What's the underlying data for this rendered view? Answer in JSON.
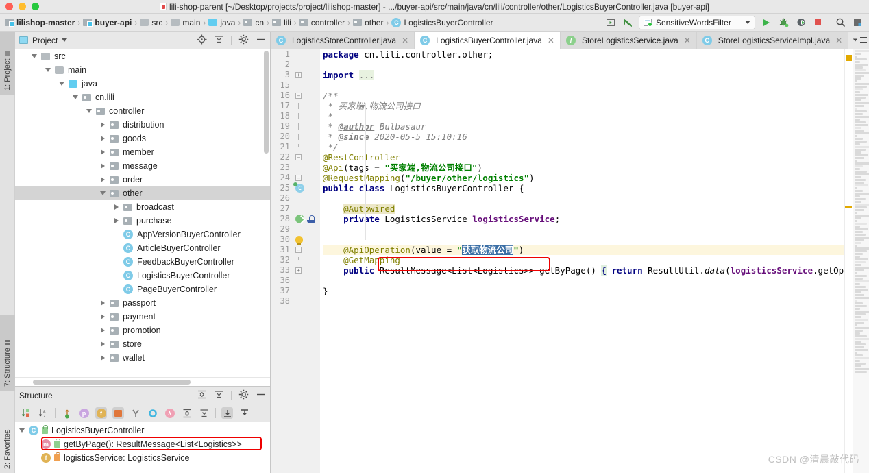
{
  "window": {
    "title": "lili-shop-parent [~/Desktop/projects/project/lilishop-master] - .../buyer-api/src/main/java/cn/lili/controller/other/LogisticsBuyerController.java [buyer-api]"
  },
  "navbar": {
    "breadcrumbs": [
      {
        "label": "lilishop-master",
        "icon": "module-icon",
        "bold": true
      },
      {
        "label": "buyer-api",
        "icon": "module-icon",
        "bold": true
      },
      {
        "label": "src",
        "icon": "folder-icon",
        "bold": false
      },
      {
        "label": "main",
        "icon": "folder-icon",
        "bold": false
      },
      {
        "label": "java",
        "icon": "source-folder-icon",
        "bold": false
      },
      {
        "label": "cn",
        "icon": "package-icon",
        "bold": false
      },
      {
        "label": "lili",
        "icon": "package-icon",
        "bold": false
      },
      {
        "label": "controller",
        "icon": "package-icon",
        "bold": false
      },
      {
        "label": "other",
        "icon": "package-icon",
        "bold": false
      },
      {
        "label": "LogisticsBuyerController",
        "icon": "class-icon",
        "bold": false
      }
    ],
    "separator": "›",
    "run_config": "SensitiveWordsFilter",
    "actions": [
      "run-button",
      "debug-button",
      "run-coverage-button",
      "stop-button",
      "search-everywhere-button",
      "layout-button"
    ]
  },
  "project_panel": {
    "title": "Project",
    "tree": [
      {
        "label": "src",
        "depth": 2,
        "arrow": "down",
        "icon": "folder-icon",
        "selected": false
      },
      {
        "label": "main",
        "depth": 3,
        "arrow": "down",
        "icon": "folder-icon",
        "selected": false
      },
      {
        "label": "java",
        "depth": 4,
        "arrow": "down",
        "icon": "source-folder-icon",
        "selected": false
      },
      {
        "label": "cn.lili",
        "depth": 5,
        "arrow": "down",
        "icon": "package-icon",
        "selected": false
      },
      {
        "label": "controller",
        "depth": 6,
        "arrow": "down",
        "icon": "package-icon",
        "selected": false
      },
      {
        "label": "distribution",
        "depth": 7,
        "arrow": "right",
        "icon": "package-icon",
        "selected": false
      },
      {
        "label": "goods",
        "depth": 7,
        "arrow": "right",
        "icon": "package-icon",
        "selected": false
      },
      {
        "label": "member",
        "depth": 7,
        "arrow": "right",
        "icon": "package-icon",
        "selected": false
      },
      {
        "label": "message",
        "depth": 7,
        "arrow": "right",
        "icon": "package-icon",
        "selected": false
      },
      {
        "label": "order",
        "depth": 7,
        "arrow": "right",
        "icon": "package-icon",
        "selected": false
      },
      {
        "label": "other",
        "depth": 7,
        "arrow": "down",
        "icon": "package-icon",
        "selected": true
      },
      {
        "label": "broadcast",
        "depth": 8,
        "arrow": "right",
        "icon": "package-icon",
        "selected": false
      },
      {
        "label": "purchase",
        "depth": 8,
        "arrow": "right",
        "icon": "package-icon",
        "selected": false
      },
      {
        "label": "AppVersionBuyerController",
        "depth": 8,
        "arrow": "none",
        "icon": "class-icon",
        "selected": false
      },
      {
        "label": "ArticleBuyerController",
        "depth": 8,
        "arrow": "none",
        "icon": "class-icon",
        "selected": false
      },
      {
        "label": "FeedbackBuyerController",
        "depth": 8,
        "arrow": "none",
        "icon": "class-icon",
        "selected": false
      },
      {
        "label": "LogisticsBuyerController",
        "depth": 8,
        "arrow": "none",
        "icon": "class-icon",
        "selected": false
      },
      {
        "label": "PageBuyerController",
        "depth": 8,
        "arrow": "none",
        "icon": "class-icon",
        "selected": false
      },
      {
        "label": "passport",
        "depth": 7,
        "arrow": "right",
        "icon": "package-icon",
        "selected": false
      },
      {
        "label": "payment",
        "depth": 7,
        "arrow": "right",
        "icon": "package-icon",
        "selected": false
      },
      {
        "label": "promotion",
        "depth": 7,
        "arrow": "right",
        "icon": "package-icon",
        "selected": false
      },
      {
        "label": "store",
        "depth": 7,
        "arrow": "right",
        "icon": "package-icon",
        "selected": false
      },
      {
        "label": "wallet",
        "depth": 7,
        "arrow": "right",
        "icon": "package-icon",
        "selected": false
      }
    ]
  },
  "structure_panel": {
    "title": "Structure",
    "items": [
      {
        "label": "LogisticsBuyerController",
        "depth": 0,
        "arrow": "down",
        "kind": "class-icon",
        "visibility": "public",
        "highlighted": false
      },
      {
        "label": "getByPage(): ResultMessage<List<Logistics>>",
        "depth": 1,
        "arrow": "none",
        "kind": "method-icon",
        "visibility": "public",
        "highlighted": true
      },
      {
        "label": "logisticsService: LogisticsService",
        "depth": 1,
        "arrow": "none",
        "kind": "field-icon",
        "visibility": "private",
        "highlighted": false
      }
    ],
    "toolbar_icons": [
      "sort-by-visibility-icon",
      "sort-alphabetically-icon",
      "show-inherited-icon",
      "show-properties-icon",
      "show-fields-icon",
      "show-non-public-icon",
      "show-anonymous-icon",
      "show-interfaces-icon",
      "show-lambdas-icon",
      "expand-all-icon",
      "collapse-all-icon",
      "autoscroll-to-source-icon",
      "autoscroll-from-source-icon"
    ]
  },
  "sidebar_tabs": {
    "left": [
      {
        "label": "1: Project",
        "active": true
      },
      {
        "label": "7: Structure",
        "active": true
      },
      {
        "label": "2: Favorites",
        "active": false
      }
    ]
  },
  "editor": {
    "tabs": [
      {
        "label": "LogisticsStoreController.java",
        "icon": "class-icon",
        "active": false
      },
      {
        "label": "LogisticsBuyerController.java",
        "icon": "class-icon",
        "active": true
      },
      {
        "label": "StoreLogisticsService.java",
        "icon": "interface-icon",
        "active": false
      },
      {
        "label": "StoreLogisticsServiceImpl.java",
        "icon": "class-icon",
        "active": false
      }
    ],
    "tab_overflow_count": "2",
    "lines": [
      {
        "num": "1",
        "fold": "none",
        "gutter": "",
        "html": "<span class=\"kw\">package</span> <span class=\"plain\">cn.lili.controller.other;</span>"
      },
      {
        "num": "2",
        "fold": "none",
        "gutter": "",
        "html": ""
      },
      {
        "num": "3",
        "fold": "plus",
        "gutter": "",
        "html": "<span class=\"kw\">import</span> <span class=\"dots-green\">...</span>"
      },
      {
        "num": "15",
        "fold": "none",
        "gutter": "",
        "html": ""
      },
      {
        "num": "16",
        "fold": "open",
        "gutter": "",
        "html": "<span class=\"cmt\">/**</span>"
      },
      {
        "num": "17",
        "fold": "bar",
        "gutter": "",
        "html": "<span class=\"cmt\"> * 买家端,物流公司接口</span>"
      },
      {
        "num": "18",
        "fold": "bar",
        "gutter": "",
        "html": "<span class=\"cmt\"> * </span>"
      },
      {
        "num": "19",
        "fold": "bar",
        "gutter": "",
        "html": "<span class=\"cmt\"> * </span><span class=\"cmt-tag\">@author</span><span class=\"cmt\"> Bulbasaur</span>"
      },
      {
        "num": "20",
        "fold": "bar",
        "gutter": "",
        "html": "<span class=\"cmt\"> * </span><span class=\"cmt-tag\">@since</span><span class=\"cmt\"> 2020-05-5 15:10:16</span>"
      },
      {
        "num": "21",
        "fold": "end",
        "gutter": "",
        "html": "<span class=\"cmt\"> */</span>"
      },
      {
        "num": "22",
        "fold": "open",
        "gutter": "",
        "html": "<span class=\"ann\">@RestController</span>"
      },
      {
        "num": "23",
        "fold": "none",
        "gutter": "",
        "html": "<span class=\"ann\">@Api</span><span class=\"plain\">(tags = </span><span class=\"str\">\"买家端,物流公司接口\"</span><span class=\"plain\">)</span>"
      },
      {
        "num": "24",
        "fold": "open",
        "gutter": "",
        "html": "<span class=\"ann\">@RequestMapping</span><span class=\"plain\">(</span><span class=\"str\">\"/buyer/other/logistics\"</span><span class=\"plain\">)</span>"
      },
      {
        "num": "25",
        "fold": "none",
        "gutter": "bean",
        "html": "<span class=\"kw\">public class</span> <span class=\"plain\">LogisticsBuyerController {</span>"
      },
      {
        "num": "26",
        "fold": "none",
        "gutter": "",
        "html": ""
      },
      {
        "num": "27",
        "fold": "none",
        "gutter": "",
        "html": "    <span class=\"ann-hl\">@Autowired</span>"
      },
      {
        "num": "28",
        "fold": "none",
        "gutter": "impl-java",
        "html": "    <span class=\"kw\">private</span> <span class=\"plain\">LogisticsService </span><span class=\"fld\">logisticsService</span><span class=\"plain\">;</span>"
      },
      {
        "num": "29",
        "fold": "none",
        "gutter": "",
        "html": ""
      },
      {
        "num": "30",
        "fold": "none",
        "gutter": "bulb",
        "html": ""
      },
      {
        "num": "31",
        "fold": "open",
        "gutter": "",
        "highlight": true,
        "html": "    <span class=\"ann\">@ApiOperation</span><span class=\"plain\">(value = </span><span class=\"str\">\"</span><span class=\"selstr\">获取物流公司</span><span class=\"str\">\"</span><span class=\"plain\">)</span>"
      },
      {
        "num": "32",
        "fold": "end",
        "gutter": "",
        "html": "    <span class=\"ann\">@GetMapping</span>"
      },
      {
        "num": "33",
        "fold": "plus",
        "gutter": "",
        "html": "    <span class=\"kw\">public</span> <span class=\"plain\">ResultMessage&lt;List&lt;Logistics&gt;&gt; getByPage() </span><span class=\"braceg\">{</span> <span class=\"kw\">return</span> <span class=\"plain\">ResultUtil.</span><span class=\"statici\">data</span><span class=\"plain\">(</span><span class=\"fld\">logisticsService</span><span class=\"plain\">.getOpenLogistics(</span>"
      },
      {
        "num": "36",
        "fold": "none",
        "gutter": "",
        "html": ""
      },
      {
        "num": "37",
        "fold": "none",
        "gutter": "",
        "html": "<span class=\"plain\">}</span>"
      },
      {
        "num": "38",
        "fold": "none",
        "gutter": "",
        "html": ""
      }
    ]
  },
  "annotations": {
    "field_box": "LogisticsService logisticsService;",
    "structure_box": "getByPage(): ResultMessage<List<Logistics>>",
    "api_string_selection": "获取物流公司",
    "box_color": "#ee0000"
  },
  "watermark": "CSDN @清晨敲代码",
  "colors": {
    "keyword": "#000080",
    "annotation": "#808000",
    "string": "#008000",
    "comment": "#808080",
    "field": "#660e7a",
    "selection": "#3a6ea5",
    "highlight_line": "#fdf6dd",
    "accent_blue": "#62cdf0",
    "run_green": "#27c93f"
  }
}
